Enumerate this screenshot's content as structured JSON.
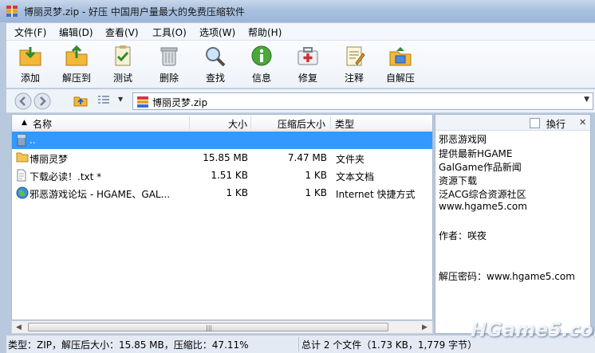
{
  "window": {
    "title": "博丽灵梦.zip - 好压 中国用户量最大的免费压缩软件"
  },
  "menu": [
    {
      "label": "文件(F)"
    },
    {
      "label": "编辑(D)"
    },
    {
      "label": "查看(V)"
    },
    {
      "label": "工具(O)"
    },
    {
      "label": "选项(W)"
    },
    {
      "label": "帮助(H)"
    }
  ],
  "toolbar": [
    {
      "label": "添加",
      "icon": "add-icon"
    },
    {
      "label": "解压到",
      "icon": "extract-icon"
    },
    {
      "label": "测试",
      "icon": "test-icon"
    },
    {
      "label": "删除",
      "icon": "delete-icon"
    },
    {
      "label": "查找",
      "icon": "find-icon"
    },
    {
      "label": "信息",
      "icon": "info-icon"
    },
    {
      "label": "修复",
      "icon": "repair-icon"
    },
    {
      "label": "注释",
      "icon": "comment-icon"
    },
    {
      "label": "自解压",
      "icon": "sfx-icon"
    }
  ],
  "address": {
    "path": "博丽灵梦.zip"
  },
  "columns": {
    "name": "名称",
    "size": "大小",
    "packed": "压缩后大小",
    "type": "类型"
  },
  "files": [
    {
      "name": "..",
      "size": "",
      "packed": "",
      "type": "",
      "icon": "parent-folder-icon",
      "selected": true
    },
    {
      "name": "博丽灵梦",
      "size": "15.85 MB",
      "packed": "7.47 MB",
      "type": "文件夹",
      "icon": "folder-icon"
    },
    {
      "name": "下载必读！.txt *",
      "size": "1.51 KB",
      "packed": "1 KB",
      "type": "文本文档",
      "icon": "text-file-icon"
    },
    {
      "name": "邪恶游戏论坛 - HGAME、GAL...",
      "size": "1 KB",
      "packed": "1 KB",
      "type": "Internet 快捷方式",
      "icon": "internet-shortcut-icon"
    }
  ],
  "comment": {
    "wrap_label": "換行",
    "lines": [
      "邪恶游戏网",
      "提供最新HGAME",
      "GalGame作品新闻",
      "资源下载",
      "泛ACG综合资源社区",
      "www.hgame5.com",
      "",
      "作者：咲夜",
      "",
      "",
      "解压密码：www.hgame5.com"
    ]
  },
  "status": {
    "left": "类型：ZIP，解压后大小：15.85 MB，压缩比：47.11%",
    "right": "总计 2 个文件（1.73 KB，1,779 字节）"
  },
  "watermark": "HGame5.com",
  "colors": {
    "selection": "#3399ff",
    "titlebar": "#a9c1df"
  }
}
